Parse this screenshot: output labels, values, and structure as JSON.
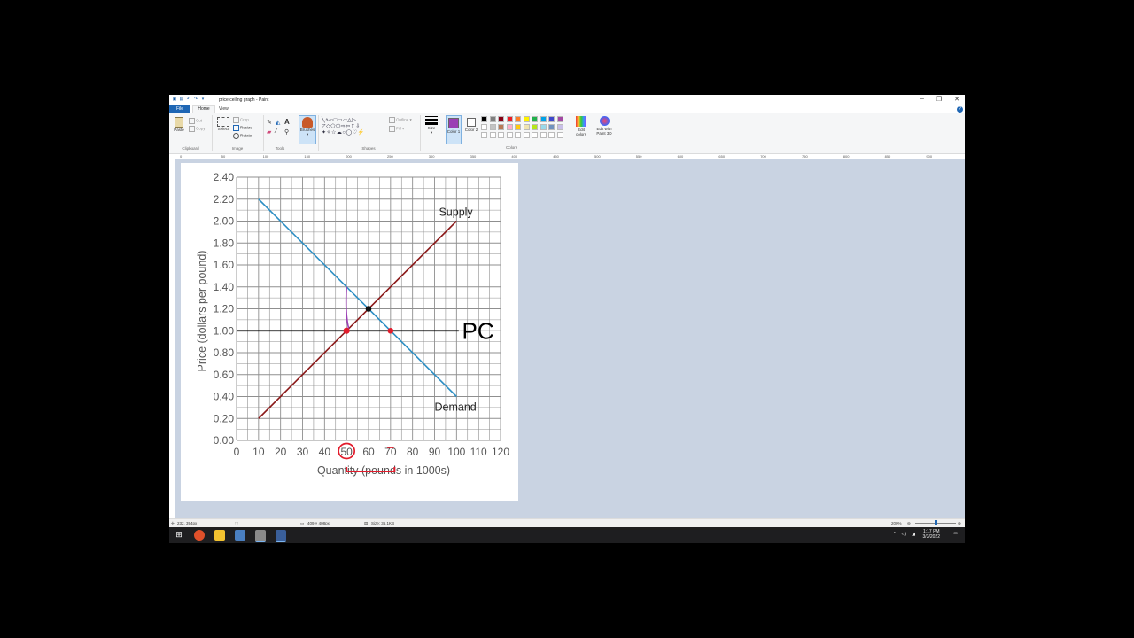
{
  "app": {
    "title": "price ceiling graph - Paint",
    "menu": {
      "file": "File",
      "home": "Home",
      "view": "View"
    },
    "help": "?"
  },
  "ribbon": {
    "clipboard": {
      "label": "Clipboard",
      "paste": "Paste",
      "cut": "Cut",
      "copy": "Copy"
    },
    "image": {
      "label": "Image",
      "select": "Select",
      "crop": "Crop",
      "resize": "Resize",
      "rotate": "Rotate"
    },
    "tools": {
      "label": "Tools"
    },
    "brushes": {
      "label": "Brushes"
    },
    "shapes": {
      "label": "Shapes",
      "outline": "Outline",
      "fill": "Fill"
    },
    "size": {
      "label": "Size"
    },
    "color1": {
      "label": "Color 1",
      "color": "#9b3fb5"
    },
    "color2": {
      "label": "Color 2",
      "color": "#ffffff"
    },
    "colors": {
      "label": "Colors",
      "palette_row1": [
        "#000000",
        "#7f7f7f",
        "#880015",
        "#ed1c24",
        "#ff7f27",
        "#fff200",
        "#22b14c",
        "#00a2e8",
        "#3f48cc",
        "#a349a4"
      ],
      "palette_row2": [
        "#ffffff",
        "#c3c3c3",
        "#b97a57",
        "#ffaec9",
        "#ffc90e",
        "#efe4b0",
        "#b5e61d",
        "#99d9ea",
        "#7092be",
        "#c8bfe7"
      ],
      "edit_colors": "Edit colors",
      "edit_paint3d": "Edit with Paint 3D"
    }
  },
  "ruler_marks": [
    "0",
    "50",
    "100",
    "150",
    "200",
    "250",
    "300",
    "350",
    "400",
    "450",
    "500",
    "550",
    "600",
    "650",
    "700",
    "750",
    "800",
    "850",
    "900"
  ],
  "chart_data": {
    "type": "line",
    "xlabel": "Quantity (pounds in 1000s)",
    "ylabel": "Price (dollars per pound)",
    "xlim": [
      0,
      120
    ],
    "ylim": [
      0,
      2.4
    ],
    "x_ticks": [
      "0",
      "10",
      "20",
      "30",
      "40",
      "50",
      "60",
      "70",
      "80",
      "90",
      "100",
      "110",
      "120"
    ],
    "y_ticks": [
      "0.00",
      "0.20",
      "0.40",
      "0.60",
      "0.80",
      "1.00",
      "1.20",
      "1.40",
      "1.60",
      "1.80",
      "2.00",
      "2.20",
      "2.40"
    ],
    "grid": true,
    "series": [
      {
        "name": "Supply",
        "color": "#8b1a1a",
        "points": [
          [
            10,
            0.2
          ],
          [
            100,
            2.0
          ]
        ]
      },
      {
        "name": "Demand",
        "color": "#2e8fc4",
        "points": [
          [
            10,
            2.2
          ],
          [
            100,
            0.4
          ]
        ]
      }
    ],
    "annotations": {
      "price_ceiling_label": "PC",
      "price_ceiling_value": 1.0,
      "equilibrium": [
        60,
        1.2
      ],
      "quantity_supplied_at_pc": [
        50,
        1.0
      ],
      "quantity_demanded_at_pc": [
        70,
        1.0
      ],
      "markup_top_price": 1.4
    }
  },
  "status": {
    "cursor": "232, 394px",
    "selection": "",
    "dimensions": "409 × 408px",
    "size": "Size: 36.1KB",
    "zoom": "200%"
  },
  "tray": {
    "time": "1:17 PM",
    "date": "3/3/2022"
  }
}
